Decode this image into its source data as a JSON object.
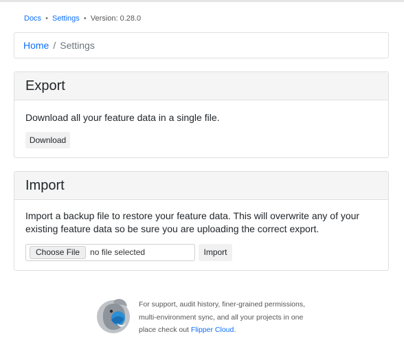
{
  "topnav": {
    "docs": "Docs",
    "sep1": "•",
    "settings": "Settings",
    "sep2": "•",
    "version": "Version: 0.28.0"
  },
  "breadcrumb": {
    "home": "Home",
    "divider": "/",
    "current": "Settings"
  },
  "export": {
    "title": "Export",
    "description": "Download all your feature data in a single file.",
    "download_label": "Download"
  },
  "import": {
    "title": "Import",
    "description": "Import a backup file to restore your feature data. This will overwrite any of your existing feature data so be sure you are uploading the correct export.",
    "choose_file_label": "Choose File",
    "no_file_text": "no file selected",
    "import_label": "Import"
  },
  "footer": {
    "text": "For support, audit history, finer-grained permissions, multi-environment sync, and all your projects in one place check out",
    "link": "Flipper Cloud",
    "period": "."
  },
  "colors": {
    "link": "#0d6efd",
    "card_header_bg": "#f5f5f5",
    "border": "#dfdfdf"
  }
}
